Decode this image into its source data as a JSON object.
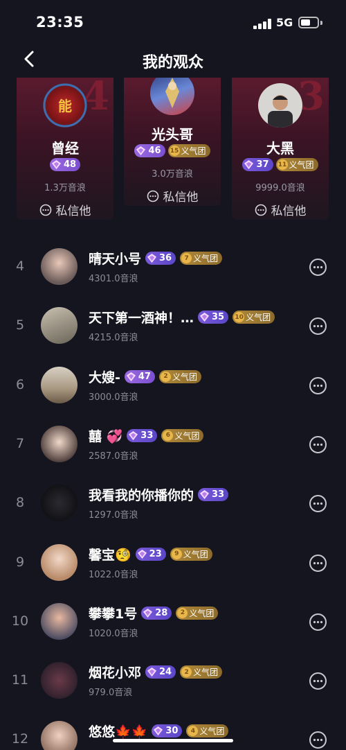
{
  "status": {
    "time": "23:35",
    "network": "5G"
  },
  "header": {
    "title": "我的观众"
  },
  "podium": [
    {
      "name": "曾经",
      "level": "48",
      "club": "",
      "wave": "1.3万音浪",
      "msg": "私信他"
    },
    {
      "name": "光头哥",
      "level": "46",
      "club": "义气团",
      "club_level": "15",
      "wave": "3.0万音浪",
      "msg": "私信他"
    },
    {
      "name": "大黑",
      "level": "37",
      "club": "义气团",
      "club_level": "11",
      "wave": "9999.0音浪",
      "msg": "私信他"
    }
  ],
  "podium_ranks": [
    "4",
    "",
    "3"
  ],
  "list": [
    {
      "rank": "4",
      "name": "晴天小号",
      "level": "36",
      "club": "义气团",
      "club_level": "7",
      "wave": "4301.0音浪"
    },
    {
      "rank": "5",
      "name": "天下第一酒神！…",
      "level": "35",
      "club": "义气团",
      "club_level": "10",
      "wave": "4215.0音浪"
    },
    {
      "rank": "6",
      "name": "大嫂-",
      "level": "47",
      "club": "义气团",
      "club_level": "2",
      "wave": "3000.0音浪"
    },
    {
      "rank": "7",
      "name": "囍 💞",
      "level": "33",
      "club": "义气团",
      "club_level": "6",
      "wave": "2587.0音浪"
    },
    {
      "rank": "8",
      "name": "我看我的你播你的",
      "level": "33",
      "club": "",
      "club_level": "",
      "wave": "1297.0音浪"
    },
    {
      "rank": "9",
      "name": "馨宝🧐",
      "level": "23",
      "club": "义气团",
      "club_level": "9",
      "wave": "1022.0音浪"
    },
    {
      "rank": "10",
      "name": "攀攀1号",
      "level": "28",
      "club": "义气团",
      "club_level": "2",
      "wave": "1020.0音浪"
    },
    {
      "rank": "11",
      "name": "烟花小邓",
      "level": "24",
      "club": "义气团",
      "club_level": "2",
      "wave": "979.0音浪"
    },
    {
      "rank": "12",
      "name": "悠悠🍁🍁",
      "level": "30",
      "club": "义气团",
      "club_level": "4",
      "wave": ""
    }
  ],
  "icons": {
    "chat": "chat-bubble-icon",
    "back": "chevron-left-icon",
    "level": "gem-icon"
  },
  "colors": {
    "background": "#151520",
    "level_badge": "#6a50d0",
    "club_badge": "#a07e34",
    "muted": "#8d8c96"
  }
}
